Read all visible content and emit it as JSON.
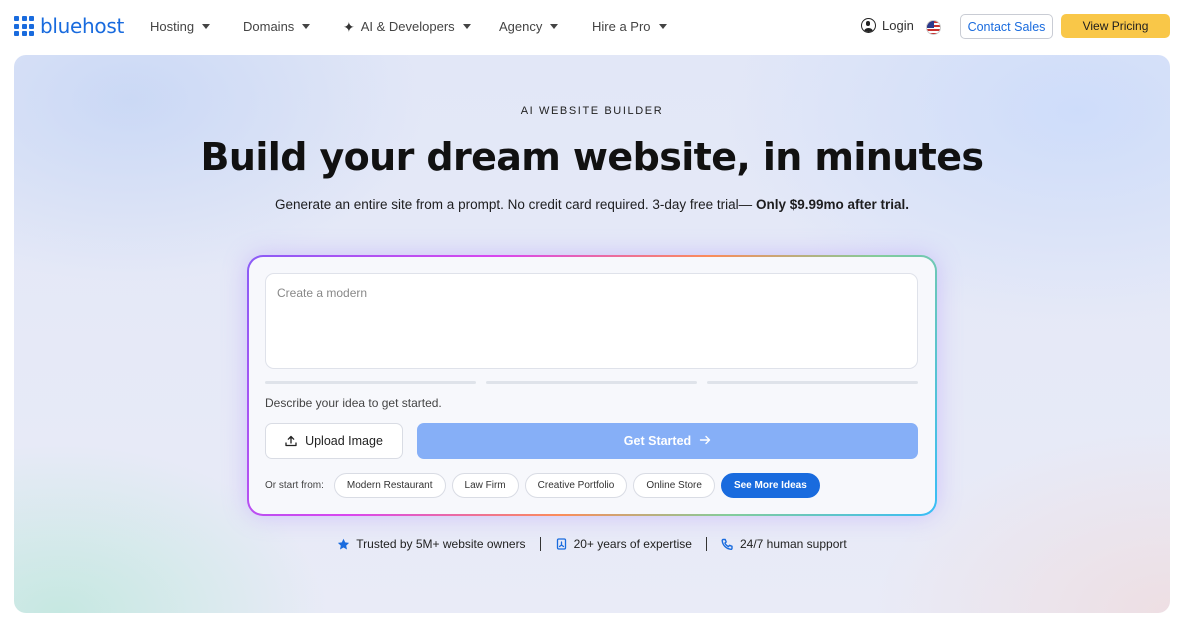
{
  "brand": {
    "name": "bluehost",
    "color": "#196bde"
  },
  "nav": {
    "items": [
      {
        "label": "Hosting",
        "has_caret": true
      },
      {
        "label": "Domains",
        "has_caret": true
      },
      {
        "label": "AI & Developers",
        "has_caret": true,
        "icon": "sparkle-icon"
      },
      {
        "label": "Agency",
        "has_caret": true
      },
      {
        "label": "Hire a Pro",
        "has_caret": true
      }
    ],
    "login_label": "Login",
    "region_icon": "us-flag-icon",
    "contact_label": "Contact Sales",
    "pricing_label": "View Pricing",
    "pricing_color": "#f9c748"
  },
  "hero": {
    "eyebrow": "AI WEBSITE BUILDER",
    "headline": "Build your dream website, in minutes",
    "subline": "Generate an entire site from a prompt. No credit card required. 3-day free trial—",
    "subline_bold": "Only $9.99mo after trial."
  },
  "builder": {
    "prompt_placeholder": "Create a modern",
    "prompt_value": "",
    "progress_steps": [
      0,
      0,
      0
    ],
    "hint": "Describe your idea to get started.",
    "upload_label": "Upload Image",
    "start_label": "Get Started",
    "start_color": "#86aff7",
    "ideas_label": "Or start from:",
    "ideas": [
      "Modern Restaurant",
      "Law Firm",
      "Creative Portfolio",
      "Online Store"
    ],
    "more_ideas_label": "See More Ideas"
  },
  "trust": [
    {
      "icon": "star-icon",
      "label": "Trusted by 5M+ website owners"
    },
    {
      "icon": "certificate-icon",
      "label": "20+ years of expertise"
    },
    {
      "icon": "phone-icon",
      "label": "24/7 human support"
    }
  ]
}
